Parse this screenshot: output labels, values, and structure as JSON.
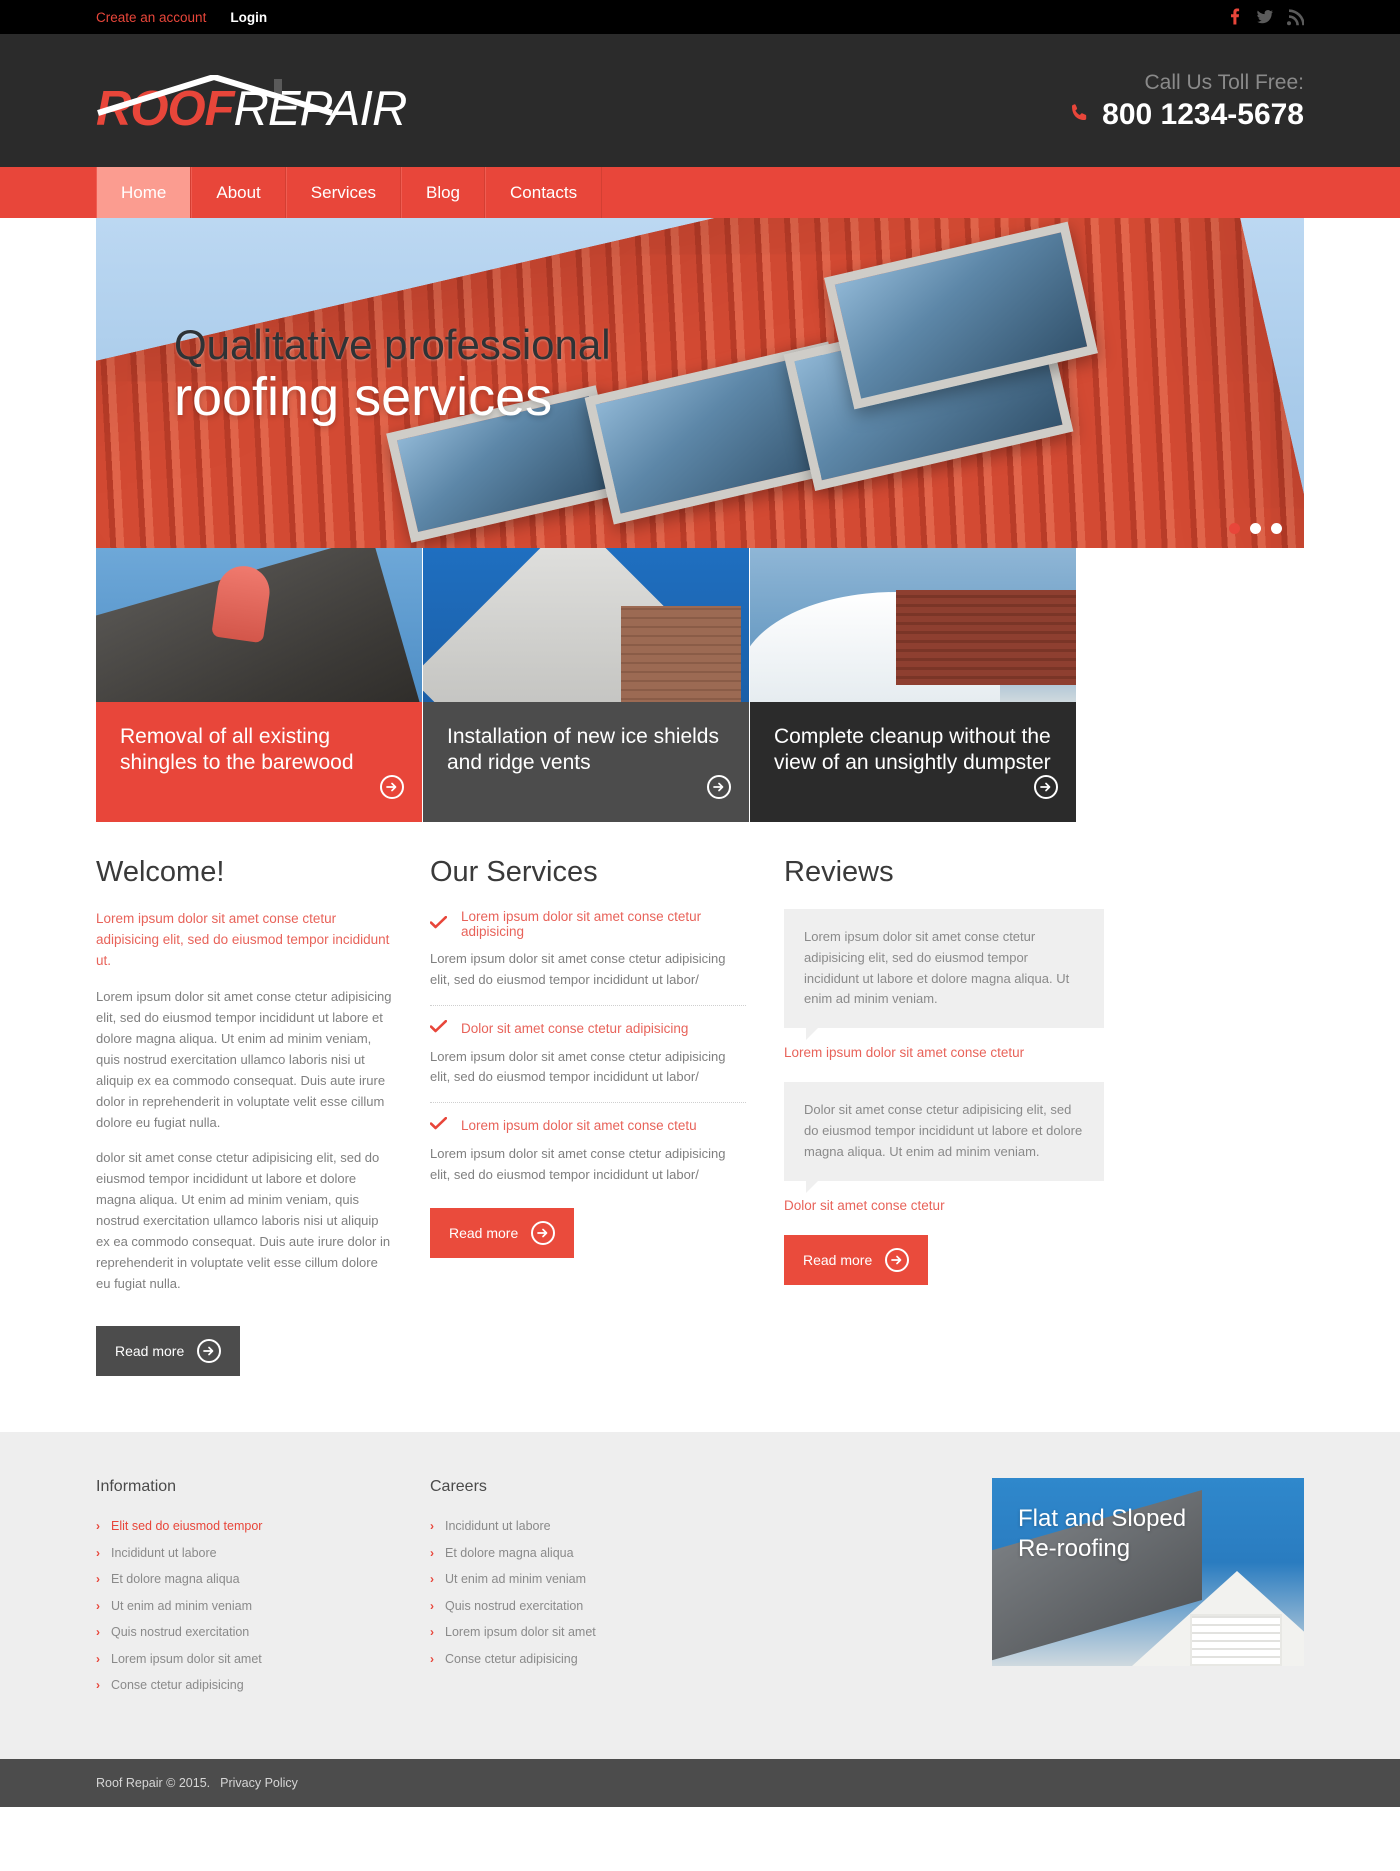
{
  "topbar": {
    "create_account": "Create an account",
    "login": "Login",
    "social": [
      {
        "name": "facebook-icon",
        "glyph": "f"
      },
      {
        "name": "twitter-icon",
        "glyph": "t"
      },
      {
        "name": "rss-icon",
        "glyph": "r"
      }
    ]
  },
  "header": {
    "logo_primary": "ROOF",
    "logo_secondary": "REPAIR",
    "call_label": "Call Us Toll Free:",
    "phone": "800 1234-5678",
    "phone_icon": "phone-icon"
  },
  "nav": {
    "items": [
      {
        "label": "Home",
        "active": true
      },
      {
        "label": "About",
        "active": false
      },
      {
        "label": "Services",
        "active": false
      },
      {
        "label": "Blog",
        "active": false
      },
      {
        "label": "Contacts",
        "active": false
      }
    ]
  },
  "hero": {
    "line1": "Qualitative professional",
    "line2": "roofing services",
    "slides": 3,
    "active_slide": 1
  },
  "features": [
    {
      "caption": "Removal of all existing shingles to the barewood",
      "style": "cap-red",
      "photo": "ph1",
      "arrow_icon": "arrow-right-circle-icon"
    },
    {
      "caption": "Installation of new ice shields and ridge vents",
      "style": "cap-gray",
      "photo": "ph2",
      "arrow_icon": "arrow-right-circle-icon"
    },
    {
      "caption": "Complete cleanup without the view of an unsightly dumpster",
      "style": "cap-dark",
      "photo": "ph3",
      "arrow_icon": "arrow-right-circle-icon"
    }
  ],
  "welcome": {
    "title": "Welcome!",
    "lead": "Lorem ipsum dolor sit amet conse ctetur adipisicing elit, sed do eiusmod tempor incididunt ut.",
    "para1": "Lorem ipsum dolor sit amet conse ctetur adipisicing elit, sed do eiusmod tempor incididunt ut labore et dolore magna aliqua. Ut enim ad minim veniam, quis nostrud exercitation ullamco laboris nisi ut aliquip ex ea commodo consequat. Duis aute irure dolor in reprehenderit in voluptate velit esse cillum dolore eu fugiat nulla.",
    "para2": "dolor sit amet conse ctetur adipisicing elit, sed do eiusmod tempor incididunt ut labore et dolore magna aliqua. Ut enim ad minim veniam, quis nostrud exercitation ullamco laboris nisi ut aliquip ex ea commodo consequat. Duis aute irure dolor in reprehenderit in voluptate velit esse cillum dolore eu fugiat nulla.",
    "button": "Read more"
  },
  "services": {
    "title": "Our Services",
    "items": [
      {
        "heading": "Lorem ipsum dolor sit amet conse ctetur adipisicing",
        "text": "Lorem ipsum dolor sit amet conse ctetur adipisicing elit, sed do eiusmod tempor incididunt ut labor/"
      },
      {
        "heading": "Dolor sit amet conse ctetur adipisicing",
        "text": "Lorem ipsum dolor sit amet conse ctetur adipisicing elit, sed do eiusmod tempor incididunt ut labor/"
      },
      {
        "heading": "Lorem ipsum dolor sit amet conse ctetu",
        "text": "Lorem ipsum dolor sit amet conse ctetur adipisicing elit, sed do eiusmod tempor incididunt ut labor/"
      }
    ],
    "button": "Read more"
  },
  "reviews": {
    "title": "Reviews",
    "items": [
      {
        "text": "Lorem ipsum dolor sit amet conse ctetur adipisicing elit, sed do eiusmod tempor incididunt ut labore et dolore magna aliqua. Ut enim ad minim veniam.",
        "author": "Lorem ipsum dolor sit amet conse ctetur"
      },
      {
        "text": "Dolor sit amet conse ctetur adipisicing elit, sed do eiusmod tempor incididunt ut labore et dolore magna aliqua. Ut enim ad minim veniam.",
        "author": "Dolor sit amet conse ctetur"
      }
    ],
    "button": "Read more"
  },
  "footer": {
    "information": {
      "title": "Information",
      "links": [
        "Elit sed do eiusmod tempor",
        "Incididunt ut labore",
        "Et dolore magna aliqua",
        "Ut enim ad minim veniam",
        "Quis nostrud exercitation",
        "Lorem ipsum dolor sit amet",
        "Conse ctetur adipisicing"
      ]
    },
    "careers": {
      "title": "Careers",
      "links": [
        "Incididunt ut labore",
        "Et dolore magna aliqua",
        "Ut enim ad minim veniam",
        "Quis nostrud exercitation",
        "Lorem ipsum dolor sit amet",
        "Conse ctetur adipisicing"
      ]
    },
    "promo": {
      "line1": "Flat and Sloped",
      "line2": "Re-roofing"
    }
  },
  "copyright": {
    "text": "Roof Repair  © 2015.",
    "privacy": "Privacy Policy"
  },
  "colors": {
    "accent": "#e8463a",
    "dark": "#2b2b2b",
    "gray": "#4c4c4c",
    "footer_bg": "#eeeeee"
  }
}
